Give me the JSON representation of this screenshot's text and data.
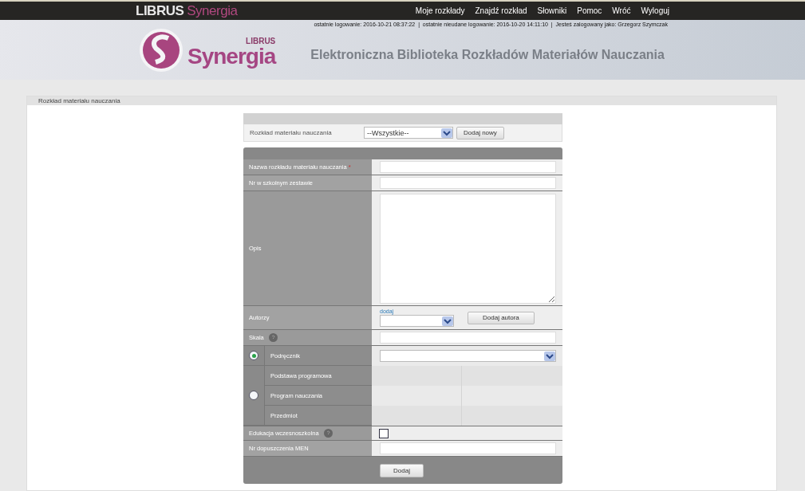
{
  "topbar": {
    "brand": "LIBRUS",
    "brand_accent": "Synergia",
    "menu": [
      "Moje rozkłady",
      "Znajdź rozkład",
      "Słowniki",
      "Pomoc",
      "Wróć",
      "Wyloguj"
    ]
  },
  "login_info": "ostatnie logowanie: 2016-10-21 08:37:22  |  ostatnie nieudane logowanie: 2016-10-20 14:11:10  |  Jesteś zalogowany jako: Grzegorz Szymczak",
  "header": {
    "logo_small": "LIBRUS",
    "logo_big": "Synergia",
    "title": "Elektroniczna Biblioteka Rozkładów Materiałów Nauczania"
  },
  "panel": {
    "title": "Rozkład materiału nauczania"
  },
  "filter": {
    "label": "Rozkład materiału nauczania",
    "select_value": "--Wszystkie--",
    "button": "Dodaj nowy"
  },
  "form": {
    "fields": [
      {
        "kind": "text",
        "label": "Nazwa rozkładu materiału nauczania",
        "required_mark": "*",
        "help": false
      },
      {
        "kind": "text",
        "label": "Nr w szkolnym zestawie",
        "help": false
      },
      {
        "kind": "textarea",
        "label": "Opis",
        "help": false
      },
      {
        "kind": "authors",
        "label": "Autorzy",
        "link": "dodaj",
        "button": "Dodaj autora",
        "help": false
      },
      {
        "kind": "text",
        "label": "Skala",
        "help": true
      },
      {
        "kind": "source",
        "options": [
          {
            "selected": true,
            "rows": [
              "Podręcznik"
            ],
            "kind": "select"
          },
          {
            "selected": false,
            "rows": [
              "Podstawa programowa",
              "Program nauczania",
              "Przedmiot"
            ],
            "kind": "empty"
          }
        ]
      },
      {
        "kind": "checkbox",
        "label": "Edukacja wczesnoszkolna",
        "help": true,
        "checked": false
      },
      {
        "kind": "text",
        "label": "Nr dopuszczenia MEN",
        "help": false
      }
    ],
    "submit": "Dodaj"
  }
}
